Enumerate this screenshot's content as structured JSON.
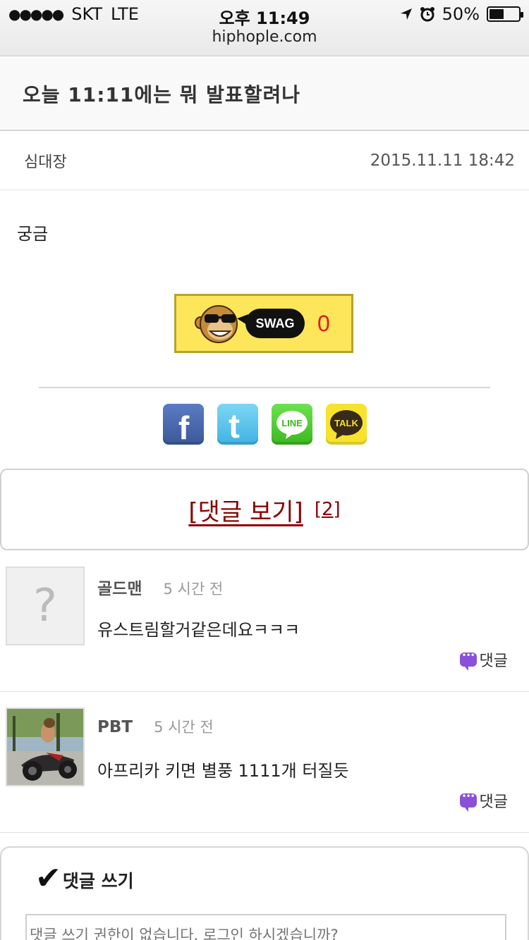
{
  "status_bar": {
    "carrier": "SKT",
    "network": "LTE",
    "time": "오후 11:49",
    "battery_percent_label": "50%",
    "battery_level": 0.5,
    "signal_dots": "●●●●●",
    "url": "hiphople.com"
  },
  "post": {
    "title": "오늘 11:11에는 뭐 발표할려나",
    "author": "심대장",
    "date": "2015.11.11 18:42",
    "body": "궁금"
  },
  "swag": {
    "label": "SWAG",
    "count": "0"
  },
  "share": {
    "facebook_icon": "f",
    "twitter_icon": "t",
    "line_label": "LINE",
    "kakaotalk_label": "TALK"
  },
  "comment_toggle": {
    "label": "[댓글 보기]",
    "count": "[2]"
  },
  "comments": [
    {
      "author": "골드맨",
      "time": "5 시간 전",
      "text": "유스트림할거같은데요ㅋㅋㅋ",
      "reply_label": "댓글",
      "avatar": "?"
    },
    {
      "author": "PBT",
      "time": "5 시간 전",
      "text": "아프리카 키면 별풍 1111개 터질듯",
      "reply_label": "댓글",
      "avatar": "photo-motorcycle"
    }
  ],
  "write_comment": {
    "title": "댓글 쓰기",
    "placeholder": "댓글 쓰기 권한이 없습니다. 로그인 하시겠습니까?"
  },
  "colors": {
    "swag_bg": "#fde65a",
    "comment_toggle_link": "#8b0000",
    "swag_count": "#e21b1b",
    "reply_icon": "#8a50d8"
  }
}
